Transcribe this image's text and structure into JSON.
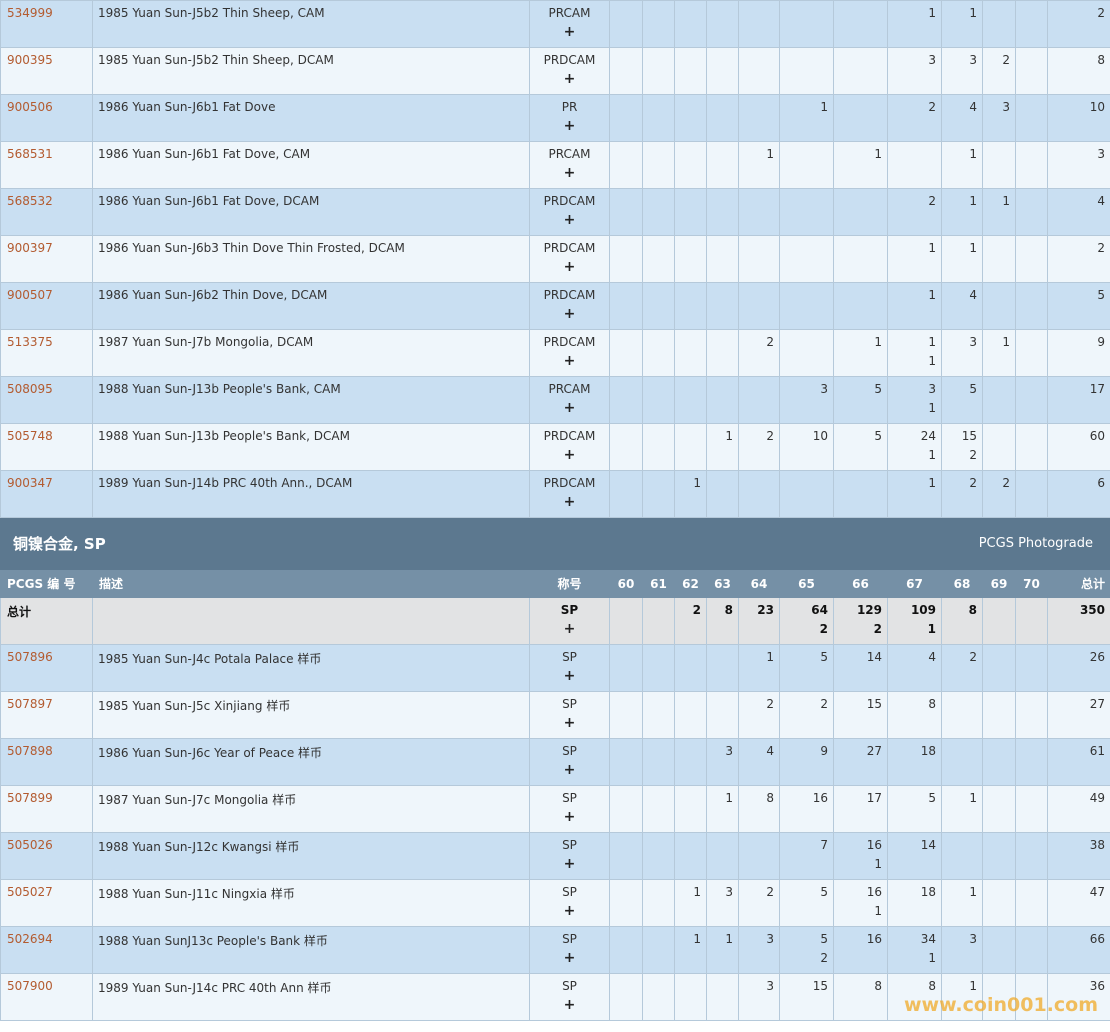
{
  "section": {
    "title": "铜镍合金, SP",
    "link": "PCGS Photograde"
  },
  "headers": {
    "pcgs_no": "PCGS 编 号",
    "desc": "描述",
    "designation": "称号",
    "total": "总计",
    "grades": [
      "60",
      "61",
      "62",
      "63",
      "64",
      "65",
      "66",
      "67",
      "68",
      "69",
      "70"
    ]
  },
  "upper_rows": [
    {
      "pcgs": "534999",
      "desc": "1985 Yuan Sun-J5b2 Thin Sheep, CAM",
      "des": "PRCAM",
      "plus": "+",
      "cells": [
        [
          "",
          ""
        ],
        [
          "",
          ""
        ],
        [
          "",
          ""
        ],
        [
          "",
          ""
        ],
        [
          "",
          ""
        ],
        [
          "",
          ""
        ],
        [
          "",
          ""
        ],
        [
          "1",
          ""
        ],
        [
          "1",
          ""
        ],
        [
          "",
          ""
        ],
        [
          "",
          ""
        ]
      ],
      "total": "2"
    },
    {
      "pcgs": "900395",
      "desc": "1985 Yuan Sun-J5b2 Thin Sheep, DCAM",
      "des": "PRDCAM",
      "plus": "+",
      "cells": [
        [
          "",
          ""
        ],
        [
          "",
          ""
        ],
        [
          "",
          ""
        ],
        [
          "",
          ""
        ],
        [
          "",
          ""
        ],
        [
          "",
          ""
        ],
        [
          "",
          ""
        ],
        [
          "3",
          ""
        ],
        [
          "3",
          ""
        ],
        [
          "2",
          ""
        ],
        [
          "",
          ""
        ]
      ],
      "total": "8"
    },
    {
      "pcgs": "900506",
      "desc": "1986 Yuan Sun-J6b1 Fat Dove",
      "des": "PR",
      "plus": "+",
      "cells": [
        [
          "",
          ""
        ],
        [
          "",
          ""
        ],
        [
          "",
          ""
        ],
        [
          "",
          ""
        ],
        [
          "",
          ""
        ],
        [
          "1",
          ""
        ],
        [
          "",
          ""
        ],
        [
          "2",
          ""
        ],
        [
          "4",
          ""
        ],
        [
          "3",
          ""
        ],
        [
          "",
          ""
        ]
      ],
      "total": "10"
    },
    {
      "pcgs": "568531",
      "desc": "1986 Yuan Sun-J6b1 Fat Dove, CAM",
      "des": "PRCAM",
      "plus": "+",
      "cells": [
        [
          "",
          ""
        ],
        [
          "",
          ""
        ],
        [
          "",
          ""
        ],
        [
          "",
          ""
        ],
        [
          "1",
          ""
        ],
        [
          "",
          ""
        ],
        [
          "1",
          ""
        ],
        [
          "",
          ""
        ],
        [
          "1",
          ""
        ],
        [
          "",
          ""
        ],
        [
          "",
          ""
        ]
      ],
      "total": "3"
    },
    {
      "pcgs": "568532",
      "desc": "1986 Yuan Sun-J6b1 Fat Dove, DCAM",
      "des": "PRDCAM",
      "plus": "+",
      "cells": [
        [
          "",
          ""
        ],
        [
          "",
          ""
        ],
        [
          "",
          ""
        ],
        [
          "",
          ""
        ],
        [
          "",
          ""
        ],
        [
          "",
          ""
        ],
        [
          "",
          ""
        ],
        [
          "2",
          ""
        ],
        [
          "1",
          ""
        ],
        [
          "1",
          ""
        ],
        [
          "",
          ""
        ]
      ],
      "total": "4"
    },
    {
      "pcgs": "900397",
      "desc": "1986 Yuan Sun-J6b3 Thin Dove Thin Frosted, DCAM",
      "des": "PRDCAM",
      "plus": "+",
      "cells": [
        [
          "",
          ""
        ],
        [
          "",
          ""
        ],
        [
          "",
          ""
        ],
        [
          "",
          ""
        ],
        [
          "",
          ""
        ],
        [
          "",
          ""
        ],
        [
          "",
          ""
        ],
        [
          "1",
          ""
        ],
        [
          "1",
          ""
        ],
        [
          "",
          ""
        ],
        [
          "",
          ""
        ]
      ],
      "total": "2"
    },
    {
      "pcgs": "900507",
      "desc": "1986 Yuan Sun-J6b2 Thin Dove, DCAM",
      "des": "PRDCAM",
      "plus": "+",
      "cells": [
        [
          "",
          ""
        ],
        [
          "",
          ""
        ],
        [
          "",
          ""
        ],
        [
          "",
          ""
        ],
        [
          "",
          ""
        ],
        [
          "",
          ""
        ],
        [
          "",
          ""
        ],
        [
          "1",
          ""
        ],
        [
          "4",
          ""
        ],
        [
          "",
          ""
        ],
        [
          "",
          ""
        ]
      ],
      "total": "5"
    },
    {
      "pcgs": "513375",
      "desc": "1987 Yuan Sun-J7b Mongolia, DCAM",
      "des": "PRDCAM",
      "plus": "+",
      "cells": [
        [
          "",
          ""
        ],
        [
          "",
          ""
        ],
        [
          "",
          ""
        ],
        [
          "",
          ""
        ],
        [
          "2",
          ""
        ],
        [
          "",
          ""
        ],
        [
          "1",
          ""
        ],
        [
          "1",
          "1"
        ],
        [
          "3",
          ""
        ],
        [
          "1",
          ""
        ],
        [
          "",
          ""
        ]
      ],
      "total": "9"
    },
    {
      "pcgs": "508095",
      "desc": "1988 Yuan Sun-J13b People's Bank, CAM",
      "des": "PRCAM",
      "plus": "+",
      "cells": [
        [
          "",
          ""
        ],
        [
          "",
          ""
        ],
        [
          "",
          ""
        ],
        [
          "",
          ""
        ],
        [
          "",
          ""
        ],
        [
          "3",
          ""
        ],
        [
          "5",
          ""
        ],
        [
          "3",
          "1"
        ],
        [
          "5",
          ""
        ],
        [
          "",
          ""
        ],
        [
          "",
          ""
        ]
      ],
      "total": "17"
    },
    {
      "pcgs": "505748",
      "desc": "1988 Yuan Sun-J13b People's Bank, DCAM",
      "des": "PRDCAM",
      "plus": "+",
      "cells": [
        [
          "",
          ""
        ],
        [
          "",
          ""
        ],
        [
          "",
          ""
        ],
        [
          "1",
          ""
        ],
        [
          "2",
          ""
        ],
        [
          "10",
          ""
        ],
        [
          "5",
          ""
        ],
        [
          "24",
          "1"
        ],
        [
          "15",
          "2"
        ],
        [
          "",
          ""
        ],
        [
          "",
          ""
        ]
      ],
      "total": "60"
    },
    {
      "pcgs": "900347",
      "desc": "1989 Yuan Sun-J14b PRC 40th Ann., DCAM",
      "des": "PRDCAM",
      "plus": "+",
      "cells": [
        [
          "",
          ""
        ],
        [
          "",
          ""
        ],
        [
          "1",
          ""
        ],
        [
          "",
          ""
        ],
        [
          "",
          ""
        ],
        [
          "",
          ""
        ],
        [
          "",
          ""
        ],
        [
          "1",
          ""
        ],
        [
          "2",
          ""
        ],
        [
          "2",
          ""
        ],
        [
          "",
          ""
        ]
      ],
      "total": "6"
    }
  ],
  "total_row": {
    "label": "总计",
    "des": "SP",
    "plus": "+",
    "cells": [
      [
        "",
        ""
      ],
      [
        "",
        ""
      ],
      [
        "2",
        ""
      ],
      [
        "8",
        ""
      ],
      [
        "23",
        ""
      ],
      [
        "64",
        "2"
      ],
      [
        "129",
        "2"
      ],
      [
        "109",
        "1"
      ],
      [
        "8",
        ""
      ],
      [
        "",
        ""
      ],
      [
        "",
        ""
      ]
    ],
    "total": "350"
  },
  "lower_rows": [
    {
      "pcgs": "507896",
      "desc": "1985 Yuan Sun-J4c Potala Palace 样币",
      "des": "SP",
      "plus": "+",
      "cells": [
        [
          "",
          ""
        ],
        [
          "",
          ""
        ],
        [
          "",
          ""
        ],
        [
          "",
          ""
        ],
        [
          "1",
          ""
        ],
        [
          "5",
          ""
        ],
        [
          "14",
          ""
        ],
        [
          "4",
          ""
        ],
        [
          "2",
          ""
        ],
        [
          "",
          ""
        ],
        [
          "",
          ""
        ]
      ],
      "total": "26"
    },
    {
      "pcgs": "507897",
      "desc": "1985 Yuan Sun-J5c Xinjiang 样币",
      "des": "SP",
      "plus": "+",
      "cells": [
        [
          "",
          ""
        ],
        [
          "",
          ""
        ],
        [
          "",
          ""
        ],
        [
          "",
          ""
        ],
        [
          "2",
          ""
        ],
        [
          "2",
          ""
        ],
        [
          "15",
          ""
        ],
        [
          "8",
          ""
        ],
        [
          "",
          ""
        ],
        [
          "",
          ""
        ],
        [
          "",
          ""
        ]
      ],
      "total": "27"
    },
    {
      "pcgs": "507898",
      "desc": "1986 Yuan Sun-J6c Year of Peace 样币",
      "des": "SP",
      "plus": "+",
      "cells": [
        [
          "",
          ""
        ],
        [
          "",
          ""
        ],
        [
          "",
          ""
        ],
        [
          "3",
          ""
        ],
        [
          "4",
          ""
        ],
        [
          "9",
          ""
        ],
        [
          "27",
          ""
        ],
        [
          "18",
          ""
        ],
        [
          "",
          ""
        ],
        [
          "",
          ""
        ],
        [
          "",
          ""
        ]
      ],
      "total": "61"
    },
    {
      "pcgs": "507899",
      "desc": "1987 Yuan Sun-J7c Mongolia 样币",
      "des": "SP",
      "plus": "+",
      "cells": [
        [
          "",
          ""
        ],
        [
          "",
          ""
        ],
        [
          "",
          ""
        ],
        [
          "1",
          ""
        ],
        [
          "8",
          ""
        ],
        [
          "16",
          ""
        ],
        [
          "17",
          ""
        ],
        [
          "5",
          ""
        ],
        [
          "1",
          ""
        ],
        [
          "",
          ""
        ],
        [
          "",
          ""
        ]
      ],
      "total": "49"
    },
    {
      "pcgs": "505026",
      "desc": "1988 Yuan Sun-J12c Kwangsi 样币",
      "des": "SP",
      "plus": "+",
      "cells": [
        [
          "",
          ""
        ],
        [
          "",
          ""
        ],
        [
          "",
          ""
        ],
        [
          "",
          ""
        ],
        [
          "",
          ""
        ],
        [
          "7",
          ""
        ],
        [
          "16",
          "1"
        ],
        [
          "14",
          ""
        ],
        [
          "",
          ""
        ],
        [
          "",
          ""
        ],
        [
          "",
          ""
        ]
      ],
      "total": "38"
    },
    {
      "pcgs": "505027",
      "desc": "1988 Yuan Sun-J11c Ningxia 样币",
      "des": "SP",
      "plus": "+",
      "cells": [
        [
          "",
          ""
        ],
        [
          "",
          ""
        ],
        [
          "1",
          ""
        ],
        [
          "3",
          ""
        ],
        [
          "2",
          ""
        ],
        [
          "5",
          ""
        ],
        [
          "16",
          "1"
        ],
        [
          "18",
          ""
        ],
        [
          "1",
          ""
        ],
        [
          "",
          ""
        ],
        [
          "",
          ""
        ]
      ],
      "total": "47"
    },
    {
      "pcgs": "502694",
      "desc": "1988 Yuan SunJ13c People's Bank 样币",
      "des": "SP",
      "plus": "+",
      "cells": [
        [
          "",
          ""
        ],
        [
          "",
          ""
        ],
        [
          "1",
          ""
        ],
        [
          "1",
          ""
        ],
        [
          "3",
          ""
        ],
        [
          "5",
          "2"
        ],
        [
          "16",
          ""
        ],
        [
          "34",
          "1"
        ],
        [
          "3",
          ""
        ],
        [
          "",
          ""
        ],
        [
          "",
          ""
        ]
      ],
      "total": "66"
    },
    {
      "pcgs": "507900",
      "desc": "1989 Yuan Sun-J14c PRC 40th Ann 样币",
      "des": "SP",
      "plus": "+",
      "cells": [
        [
          "",
          ""
        ],
        [
          "",
          ""
        ],
        [
          "",
          ""
        ],
        [
          "",
          ""
        ],
        [
          "3",
          ""
        ],
        [
          "15",
          ""
        ],
        [
          "8",
          ""
        ],
        [
          "8",
          ""
        ],
        [
          "1",
          ""
        ],
        [
          "",
          ""
        ],
        [
          "",
          ""
        ]
      ],
      "total": "36"
    }
  ],
  "watermark": "www.coin001.com"
}
